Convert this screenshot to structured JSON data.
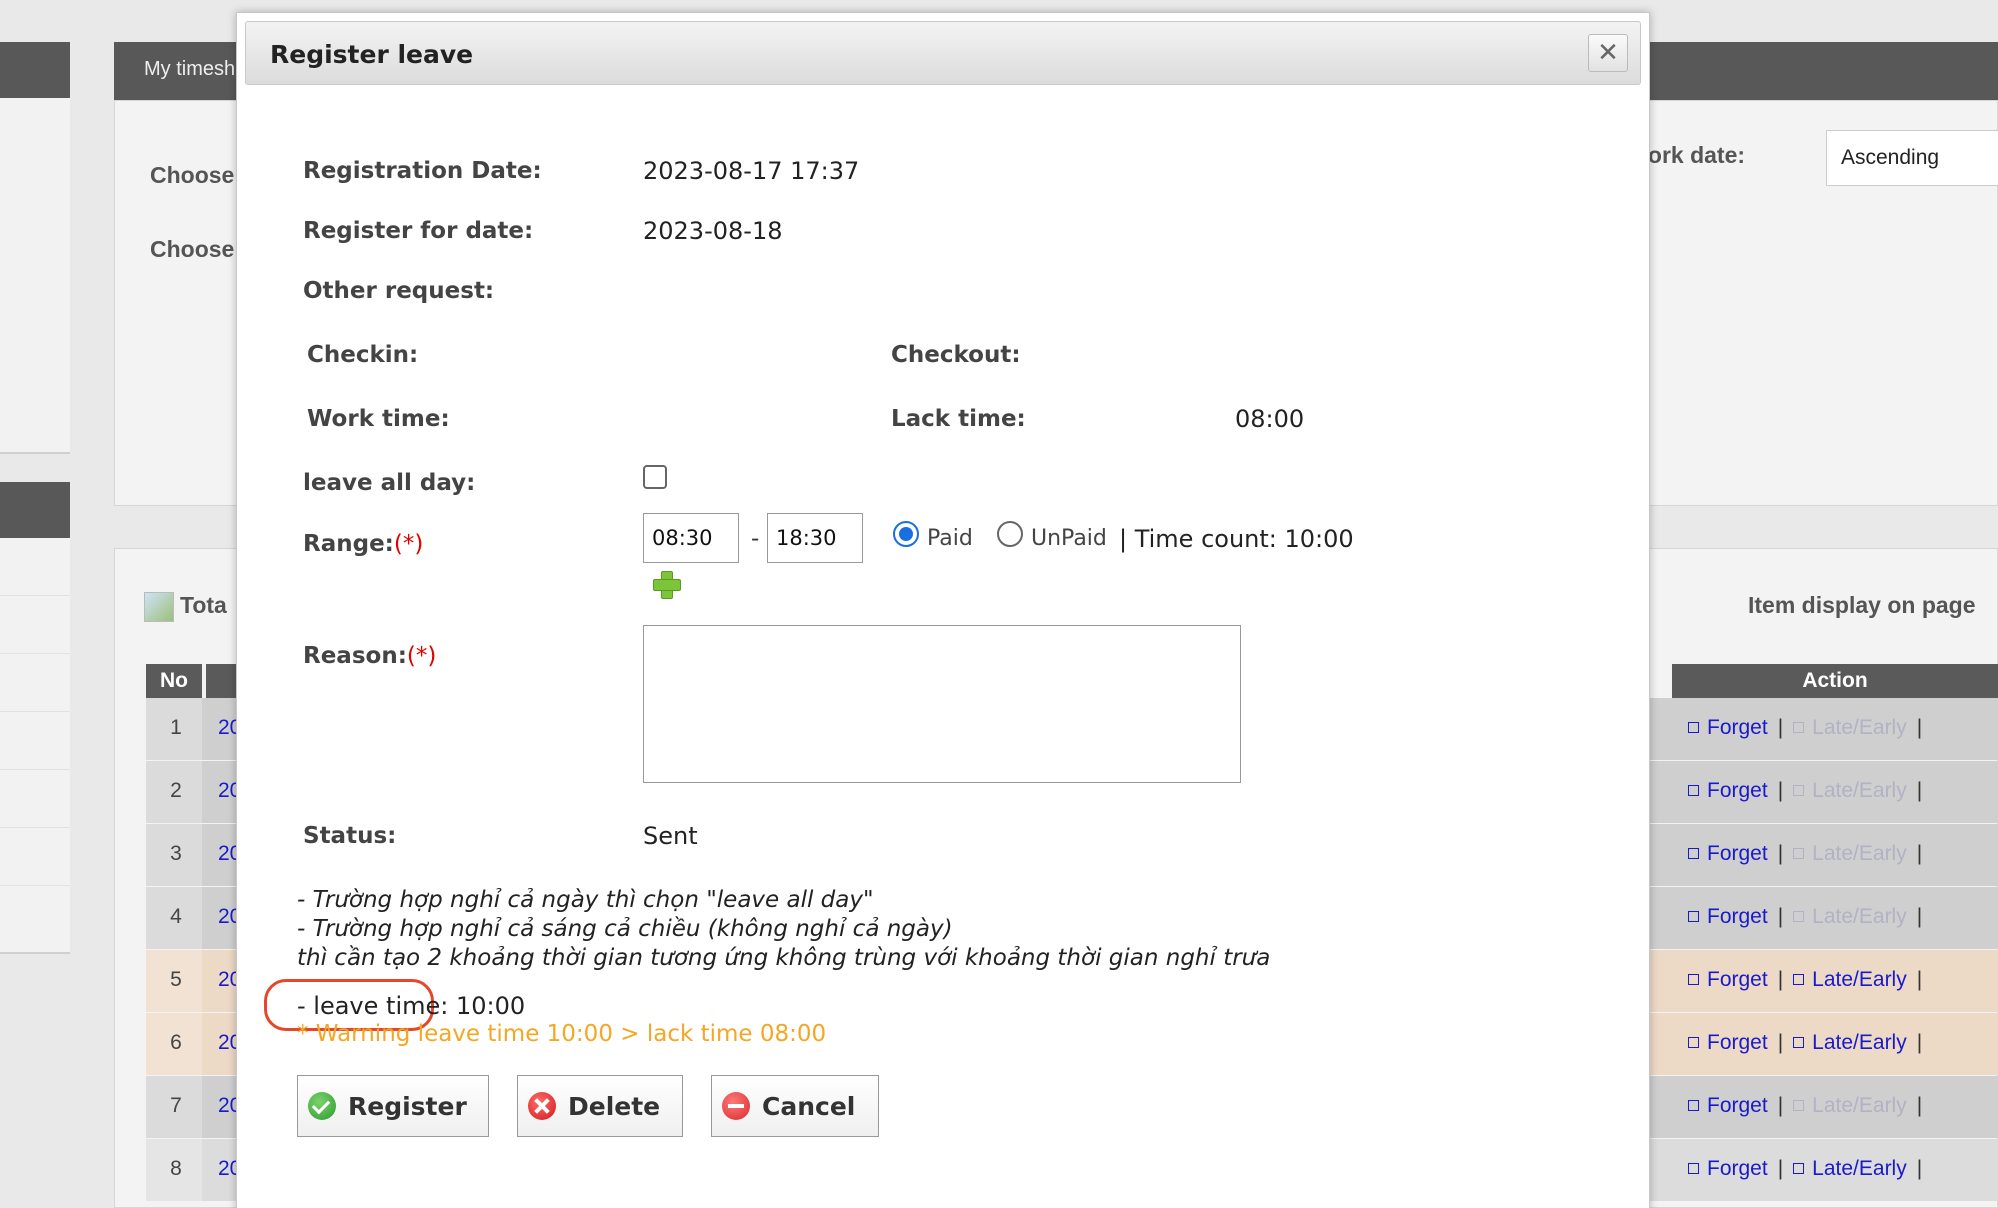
{
  "background": {
    "header_title": "My timesh",
    "filters": {
      "choose_label_1": "Choose",
      "choose_label_2": "Choose",
      "work_date_label": "work date:",
      "sort_select_value": "Ascending"
    },
    "list": {
      "total_label": "Tota",
      "item_display_label": "Item display on page",
      "col_no": "No",
      "col_action": "Action",
      "rows": [
        {
          "no": "1",
          "date": "20",
          "forget": "Forget",
          "late": "Late/Early"
        },
        {
          "no": "2",
          "date": "20",
          "forget": "Forget",
          "late": "Late/Early"
        },
        {
          "no": "3",
          "date": "20",
          "forget": "Forget",
          "late": "Late/Early"
        },
        {
          "no": "4",
          "date": "20",
          "forget": "Forget",
          "late": "Late/Early"
        },
        {
          "no": "5",
          "date": "20",
          "forget": "Forget",
          "late": "Late/Early"
        },
        {
          "no": "6",
          "date": "20",
          "forget": "Forget",
          "late": "Late/Early"
        },
        {
          "no": "7",
          "date": "20",
          "forget": "Forget",
          "late": "Late/Early"
        },
        {
          "no": "8",
          "date": "20",
          "forget": "Forget",
          "late": "Late/Early"
        }
      ],
      "separator": "|"
    }
  },
  "modal": {
    "title": "Register leave",
    "close_symbol": "✕",
    "registration_date_label": "Registration Date:",
    "registration_date_value": "2023-08-17 17:37",
    "register_for_date_label": "Register for date:",
    "register_for_date_value": "2023-08-18",
    "other_request_label": "Other request:",
    "checkin_label": "Checkin:",
    "checkout_label": "Checkout:",
    "work_time_label": "Work time:",
    "lack_time_label": "Lack time:",
    "lack_time_value": "08:00",
    "leave_all_day_label": "leave all day:",
    "range_label": "Range:",
    "required_mark": "(*)",
    "range_from": "08:30",
    "range_dash": "-",
    "range_to": "18:30",
    "paid_label": "Paid",
    "unpaid_label": "UnPaid",
    "time_count_text": "| Time count: 10:00",
    "reason_label": "Reason:",
    "status_label": "Status:",
    "status_value": "Sent",
    "notes": [
      "- Trường hợp nghỉ cả ngày thì chọn \"leave all day\"",
      "- Trường hợp nghỉ cả sáng cả chiều (không nghỉ cả ngày)",
      "thì cần tạo 2 khoảng thời gian tương ứng không trùng với khoảng thời gian nghỉ trưa"
    ],
    "leave_time_text": "- leave time: 10:00",
    "warning_text": "* Warning leave time 10:00 > lack time 08:00",
    "buttons": {
      "register": "Register",
      "delete": "Delete",
      "cancel": "Cancel"
    }
  },
  "colors": {
    "required": "#e00000",
    "warning": "#f5a623",
    "link": "#1a1acc",
    "highlight_ring": "#e5472b",
    "radio_selected": "#1a6fe0"
  }
}
